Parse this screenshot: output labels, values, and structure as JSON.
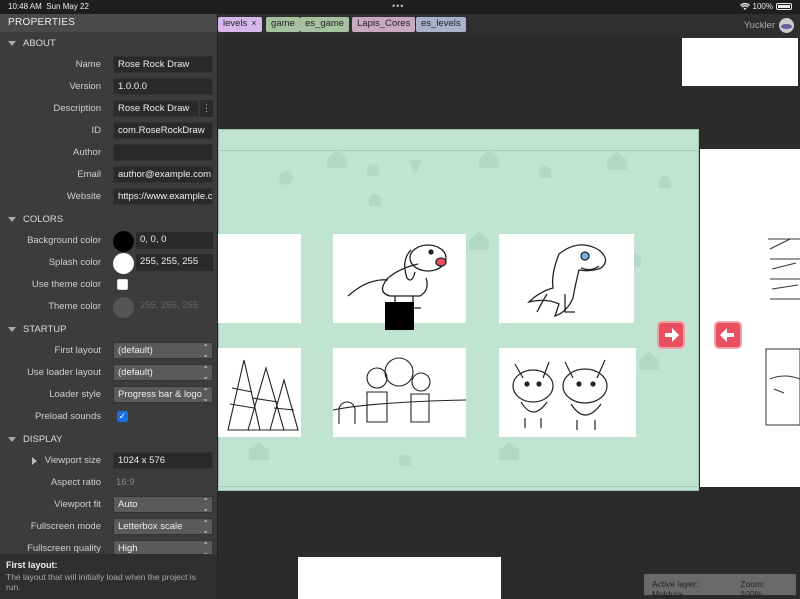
{
  "status_bar": {
    "time": "10:48 AM",
    "date": "Sun May 22",
    "battery": "100%"
  },
  "panel": {
    "title": "PROPERTIES",
    "sections": {
      "about": "ABOUT",
      "colors": "COLORS",
      "startup": "STARTUP",
      "display": "DISPLAY"
    },
    "about": {
      "name_label": "Name",
      "name": "Rose Rock Draw",
      "version_label": "Version",
      "version": "1.0.0.0",
      "description_label": "Description",
      "description": "Rose Rock Draw",
      "id_label": "ID",
      "id": "com.RoseRockDraw",
      "author_label": "Author",
      "author": "",
      "email_label": "Email",
      "email": "author@example.com",
      "website_label": "Website",
      "website": "https://www.example.com"
    },
    "colors": {
      "background_label": "Background color",
      "background": "0, 0, 0",
      "background_swatch": "#000000",
      "splash_label": "Splash color",
      "splash": "255, 255, 255",
      "splash_swatch": "#ffffff",
      "use_theme_label": "Use theme color",
      "use_theme": false,
      "theme_label": "Theme color",
      "theme": "255, 255, 255",
      "theme_swatch": "#6a6a6a"
    },
    "startup": {
      "first_layout_label": "First layout",
      "first_layout": "(default)",
      "loader_layout_label": "Use loader layout",
      "loader_layout": "(default)",
      "loader_style_label": "Loader style",
      "loader_style": "Progress bar & logo",
      "preload_label": "Preload sounds",
      "preload": true
    },
    "display": {
      "viewport_size_label": "Viewport size",
      "viewport_size": "1024 x 576",
      "aspect_label": "Aspect ratio",
      "aspect": "16:9",
      "viewport_fit_label": "Viewport fit",
      "viewport_fit": "Auto",
      "fullscreen_mode_label": "Fullscreen mode",
      "fullscreen_mode": "Letterbox scale",
      "fullscreen_quality_label": "Fullscreen quality",
      "fullscreen_quality": "High"
    },
    "help": {
      "title": "First layout:",
      "text": "The layout that will initially load when the project is run."
    }
  },
  "tabs": [
    {
      "label": "levels",
      "active": true,
      "color": "#d6b8ec"
    },
    {
      "label": "game",
      "color": "#a7c2a0"
    },
    {
      "label": "es_game",
      "color": "#a7c2a0"
    },
    {
      "label": "Lapis_Cores",
      "color": "#c9a9c0"
    },
    {
      "label": "es_levels",
      "color": "#a9b2c9"
    }
  ],
  "user": {
    "name": "Yuckler"
  },
  "canvas": {
    "mint_color": "#c0e3d2",
    "accent_color": "#e85060"
  },
  "status_panel": {
    "active_layer": "Active layer: Moldura",
    "zoom": "Zoom: 100%"
  }
}
